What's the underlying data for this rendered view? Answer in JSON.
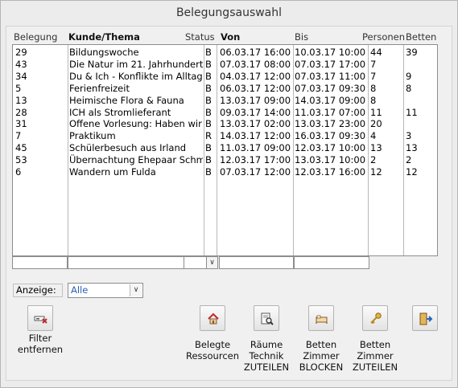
{
  "window": {
    "title": "Belegungsauswahl"
  },
  "table": {
    "headers": {
      "belegung": "Belegung",
      "kunde": "Kunde/Thema",
      "status": "Status",
      "von": "Von",
      "bis": "Bis",
      "personen": "Personen",
      "betten": "Betten"
    },
    "rows": [
      [
        "29",
        "Bildungswoche",
        "B",
        "06.03.17 16:00",
        "10.03.17 10:00",
        "44",
        "39"
      ],
      [
        "43",
        "Die Natur im 21. Jahrhundert",
        "B",
        "07.03.17 08:00",
        "07.03.17 17:00",
        "7",
        ""
      ],
      [
        "34",
        "Du & Ich - Konflikte im Alltag",
        "B",
        "04.03.17 12:00",
        "07.03.17 11:00",
        "7",
        "9"
      ],
      [
        "5",
        "Ferienfreizeit",
        "B",
        "06.03.17 12:00",
        "07.03.17 09:30",
        "8",
        "8"
      ],
      [
        "13",
        "Heimische Flora & Fauna",
        "B",
        "13.03.17 09:00",
        "14.03.17 09:00",
        "8",
        ""
      ],
      [
        "28",
        "ICH als Stromlieferant",
        "B",
        "09.03.17 14:00",
        "11.03.17 07:00",
        "11",
        "11"
      ],
      [
        "31",
        "Offene Vorlesung: Haben wir d",
        "B",
        "13.03.17 02:00",
        "13.03.17 23:00",
        "20",
        ""
      ],
      [
        "7",
        "Praktikum",
        "R",
        "14.03.17 12:00",
        "16.03.17 09:30",
        "4",
        "3"
      ],
      [
        "45",
        "Schülerbesuch aus Irland",
        "B",
        "11.03.17 09:00",
        "12.03.17 10:00",
        "13",
        "13"
      ],
      [
        "53",
        "Übernachtung Ehepaar Schmid",
        "B",
        "12.03.17 17:00",
        "13.03.17 10:00",
        "2",
        "2"
      ],
      [
        "6",
        "Wandern um Fulda",
        "B",
        "07.03.17 12:00",
        "12.03.17 16:00",
        "12",
        "12"
      ]
    ]
  },
  "filter": {
    "label": "Anzeige:",
    "value": "Alle",
    "dropdown_glyph": "∨"
  },
  "buttons": {
    "filter_remove": "Filter\nentfernen",
    "belegte_ressourcen": "Belegte\nRessourcen",
    "raeume_technik": "Räume\nTechnik\nZUTEILEN",
    "betten_blocken": "Betten\nZimmer\nBLOCKEN",
    "betten_zuteilen": "Betten\nZimmer\nZUTEILEN"
  },
  "icons": {
    "filter_remove": "filter-remove-icon",
    "belegte_ressourcen": "house-icon",
    "raeume_technik": "document-magnifier-icon",
    "betten_blocken": "bed-block-icon",
    "betten_zuteilen": "key-icon",
    "exit": "exit-door-icon"
  },
  "colors": {
    "accent_value": "#2a62b8",
    "icon_red": "#c0282d"
  }
}
